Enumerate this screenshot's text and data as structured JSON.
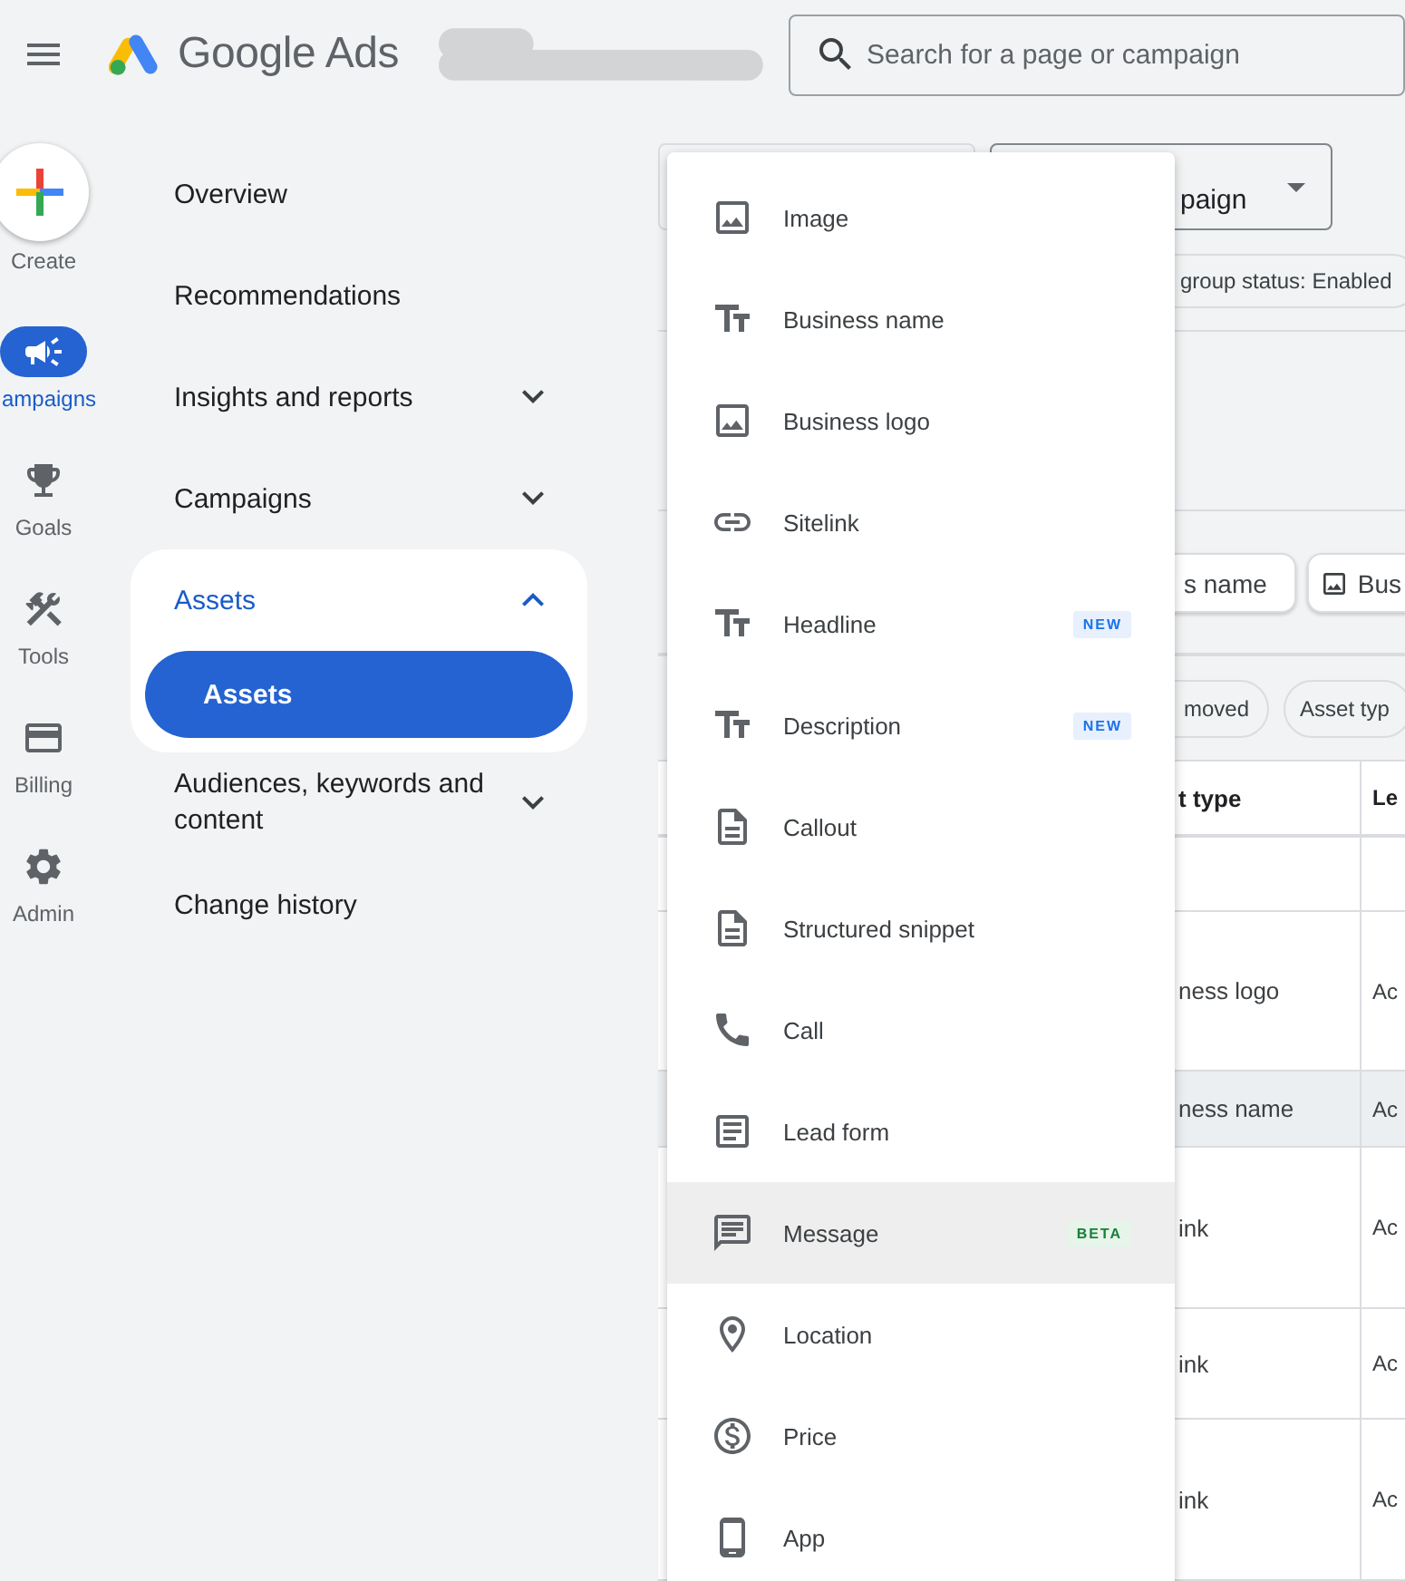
{
  "header": {
    "title": "Google Ads",
    "search": {
      "placeholder": "Search for a page or campaign"
    }
  },
  "rail": [
    {
      "label": "Create",
      "kind": "create",
      "selected": false
    },
    {
      "label": "ampaigns",
      "kind": "nav",
      "selected": true
    },
    {
      "label": "Goals",
      "kind": "nav",
      "selected": false
    },
    {
      "label": "Tools",
      "kind": "nav",
      "selected": false
    },
    {
      "label": "Billing",
      "kind": "nav",
      "selected": false
    },
    {
      "label": "Admin",
      "kind": "nav",
      "selected": false
    }
  ],
  "nav": [
    {
      "label": "Overview",
      "selected": false
    },
    {
      "label": "Recommendations",
      "selected": false
    },
    {
      "label": "Insights and reports",
      "selected": false,
      "expanded": false
    },
    {
      "label": "Campaigns",
      "selected": false,
      "expanded": false
    },
    {
      "label": "Assets",
      "selected": true,
      "expanded": true,
      "children": [
        {
          "label": "Assets",
          "selected": true
        }
      ]
    },
    {
      "label": "Audiences, keywords and content",
      "selected": false,
      "expanded": false
    },
    {
      "label": "Change history",
      "selected": false
    }
  ],
  "main": {
    "campaign_dropdown": {
      "value": "paign"
    },
    "status_chip": {
      "label": "group status: Enabled"
    },
    "asset_chips": [
      {
        "label": "s name",
        "kind": "text"
      },
      {
        "label": "Bus",
        "kind": "image"
      }
    ],
    "filter_chips": [
      {
        "label": "moved"
      },
      {
        "label": "Asset typ"
      }
    ],
    "table": {
      "columns": [
        "t type",
        "Le"
      ],
      "rows": [
        {
          "cells": [
            "ness logo",
            "Ac"
          ],
          "highlighted": false
        },
        {
          "cells": [
            "ness name",
            "Ac"
          ],
          "highlighted": true
        },
        {
          "cells": [
            "ink",
            "Ac"
          ],
          "highlighted": false
        },
        {
          "cells": [
            "ink",
            "Ac"
          ],
          "highlighted": false
        },
        {
          "cells": [
            "ink",
            "Ac"
          ],
          "highlighted": false
        }
      ]
    }
  },
  "menu": {
    "items": [
      {
        "label": "Image",
        "kind": "image",
        "highlighted": false
      },
      {
        "label": "Business name",
        "kind": "text",
        "highlighted": false
      },
      {
        "label": "Business logo",
        "kind": "image",
        "highlighted": false
      },
      {
        "label": "Sitelink",
        "kind": "link",
        "highlighted": false
      },
      {
        "label": "Headline",
        "kind": "text",
        "highlighted": false,
        "badge": {
          "text": "NEW",
          "kind": "new"
        }
      },
      {
        "label": "Description",
        "kind": "text",
        "highlighted": false,
        "badge": {
          "text": "NEW",
          "kind": "new"
        }
      },
      {
        "label": "Callout",
        "kind": "document",
        "highlighted": false
      },
      {
        "label": "Structured snippet",
        "kind": "document",
        "highlighted": false
      },
      {
        "label": "Call",
        "kind": "phone",
        "highlighted": false
      },
      {
        "label": "Lead form",
        "kind": "form",
        "highlighted": false
      },
      {
        "label": "Message",
        "kind": "message",
        "highlighted": true,
        "badge": {
          "text": "BETA",
          "kind": "beta"
        }
      },
      {
        "label": "Location",
        "kind": "location",
        "highlighted": false
      },
      {
        "label": "Price",
        "kind": "price",
        "highlighted": false
      },
      {
        "label": "App",
        "kind": "app",
        "highlighted": false
      }
    ]
  }
}
